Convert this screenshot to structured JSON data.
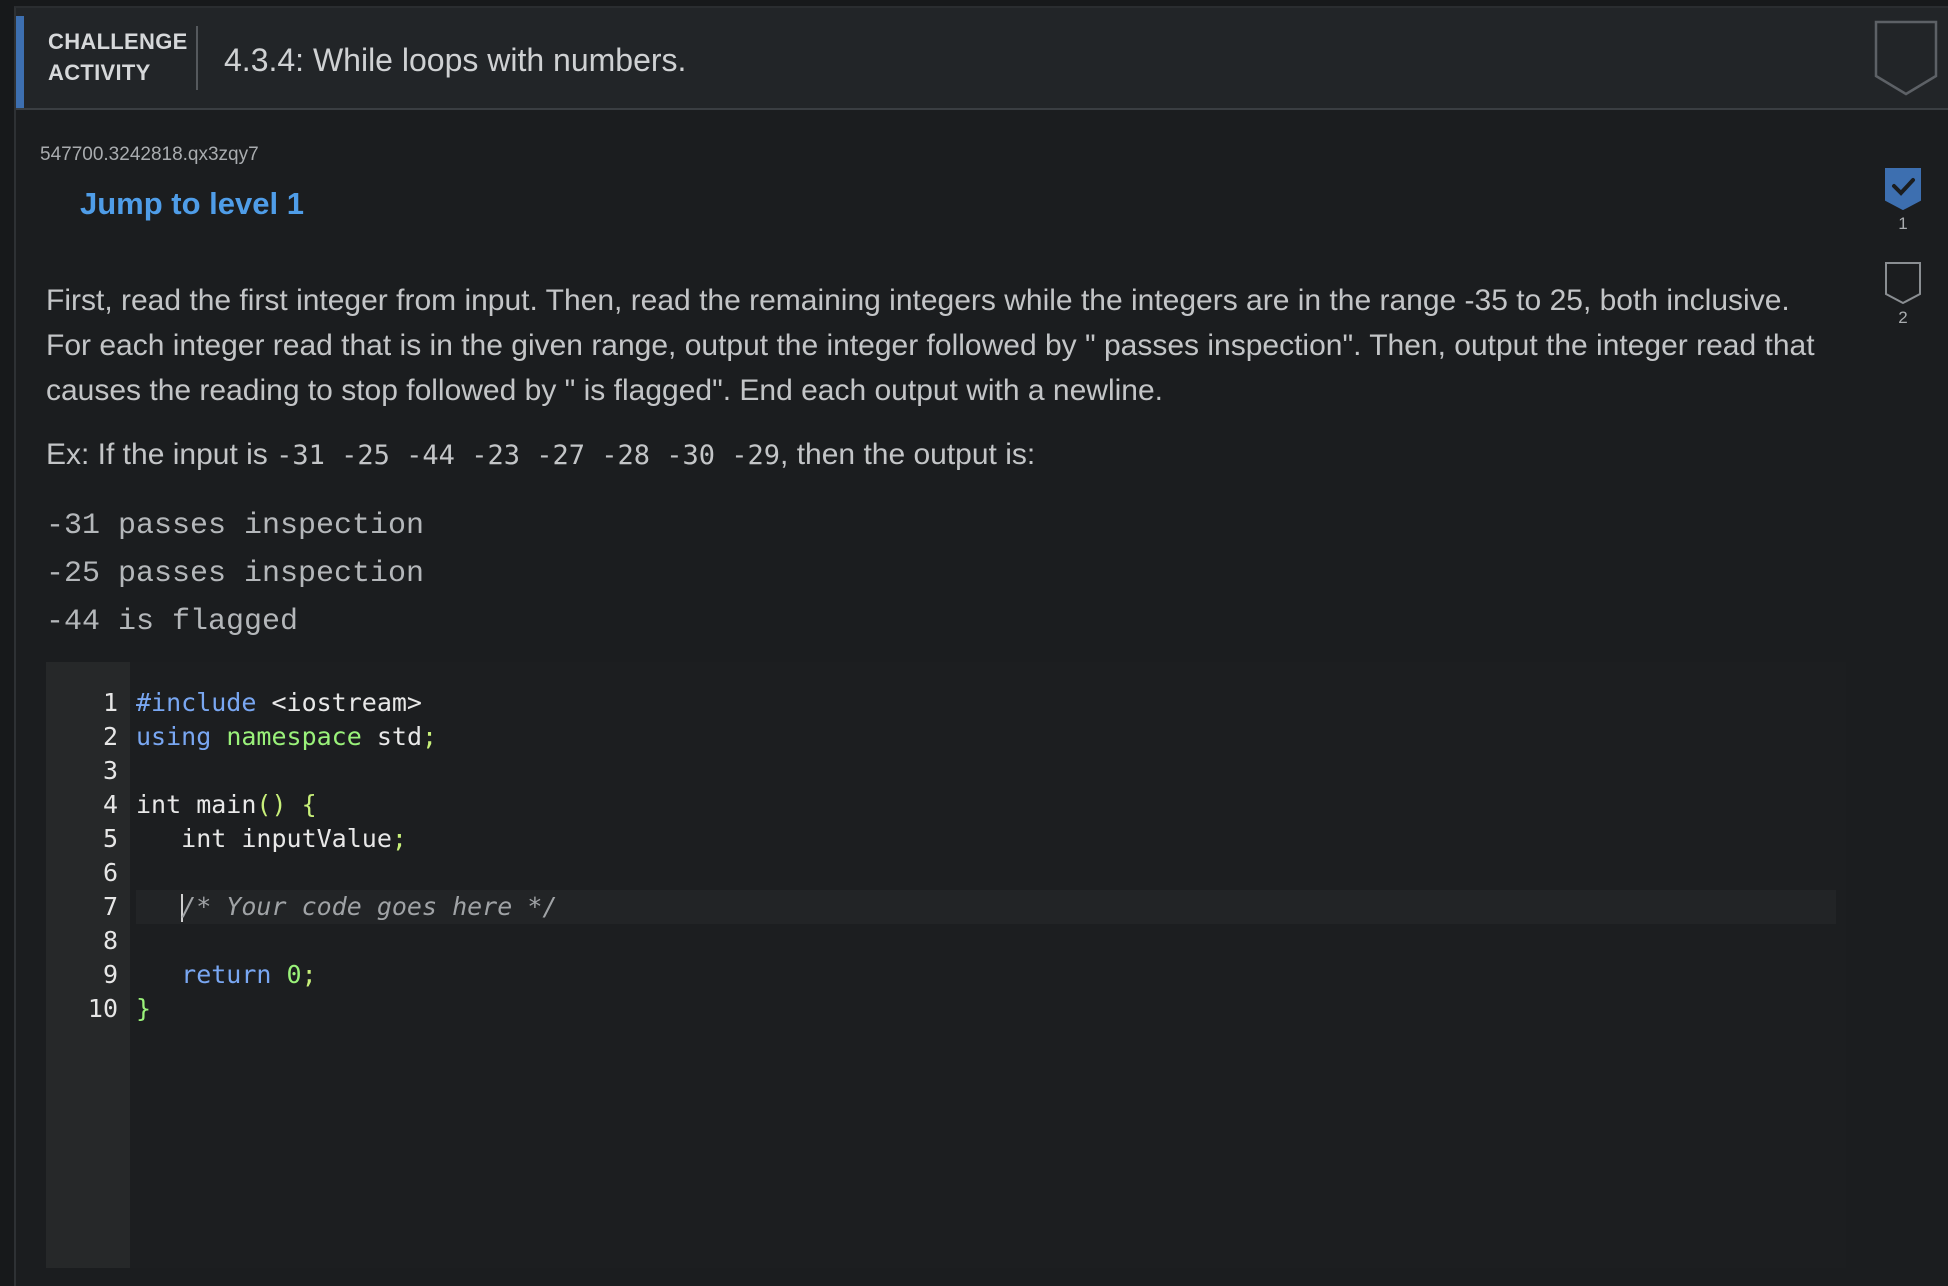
{
  "header": {
    "kind_line1": "CHALLENGE",
    "kind_line2": "ACTIVITY",
    "title": "4.3.4: While loops with numbers."
  },
  "activity_id": "547700.3242818.qx3zqy7",
  "jump_link": "Jump to level 1",
  "levels": [
    {
      "num": "1",
      "completed": true
    },
    {
      "num": "2",
      "completed": false
    }
  ],
  "instructions": "First, read the first integer from input. Then, read the remaining integers while the integers are in the range -35 to 25, both inclusive. For each integer read that is in the given range, output the integer followed by \" passes inspection\". Then, output the integer read that causes the reading to stop followed by \" is flagged\". End each output with a newline.",
  "example": {
    "prefix": "Ex: If the input is ",
    "input": "-31 -25 -44 -23 -27 -28 -30 -29",
    "suffix": ", then the output is:"
  },
  "expected_output": [
    "-31 passes inspection",
    "-25 passes inspection",
    "-44 is flagged"
  ],
  "editor": {
    "line_numbers": [
      "1",
      "2",
      "3",
      "4",
      "5",
      "6",
      "7",
      "8",
      "9",
      "10"
    ],
    "lines": {
      "l1_a": "#include",
      "l1_b": " <iostream>",
      "l2_a": "using",
      "l2_b": " ",
      "l2_c": "namespace",
      "l2_d": " std",
      "l2_e": ";",
      "l4_a": "int main",
      "l4_b": "()",
      "l4_c": " {",
      "l5_a": "   int inputValue",
      "l5_b": ";",
      "l7_comment": "/* Your code goes here */",
      "l9_a": "return",
      "l9_b": " ",
      "l9_c": "0",
      "l9_d": ";",
      "l10_a": "}"
    }
  },
  "colors": {
    "accent": "#3d6fb0",
    "link": "#4f9de8",
    "keyword_blue": "#79a7f2",
    "keyword_green": "#9af27a"
  }
}
